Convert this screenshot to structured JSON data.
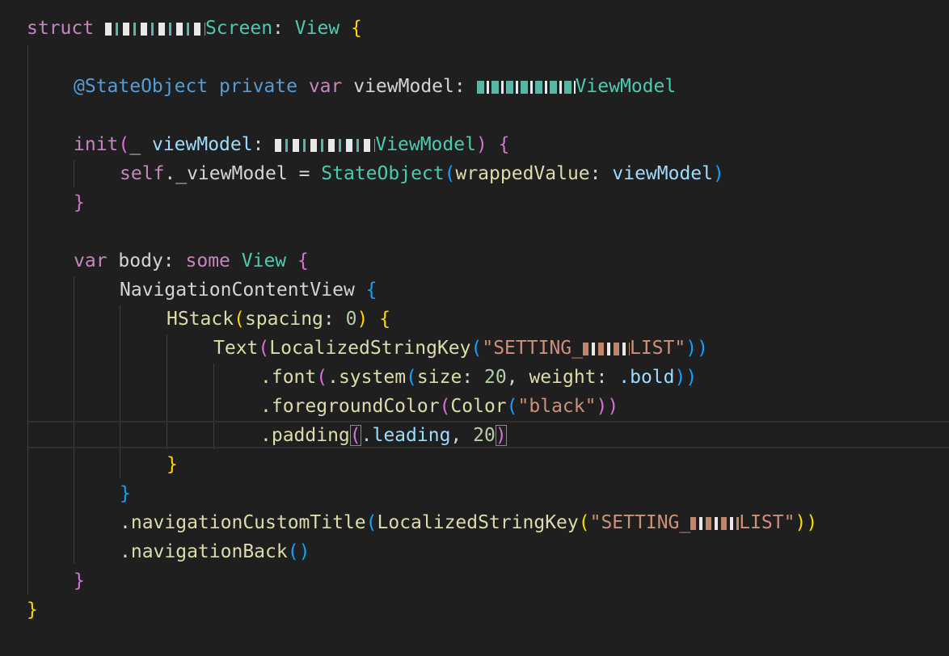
{
  "editor": {
    "lines": {
      "l1": {
        "kw_struct": "struct",
        "name_suffix": "Screen",
        "colon": ":",
        "proto": "View",
        "brace": "{"
      },
      "l3": {
        "attr": "@StateObject",
        "kw_private": "private",
        "kw_var": "var",
        "name": "viewModel",
        "colon": ":",
        "type_suffix": "ViewModel"
      },
      "l5": {
        "kw_init": "init",
        "paren": "(",
        "underscore": "_",
        "param": "viewModel",
        "colon": ":",
        "type_suffix": "ViewModel",
        "close_paren": ")",
        "brace": "{"
      },
      "l6": {
        "self": "self",
        "member": "._viewModel",
        "eq": "=",
        "ctor": "StateObject",
        "paren": "(",
        "label": "wrappedValue",
        "colon": ":",
        "arg": "viewModel",
        "close_paren": ")"
      },
      "l7": {
        "brace": "}"
      },
      "l9": {
        "kw_var": "var",
        "name": "body",
        "colon": ":",
        "kw_some": "some",
        "type": "View",
        "brace": "{"
      },
      "l10": {
        "name": "NavigationContentView",
        "brace": "{"
      },
      "l11": {
        "name": "HStack",
        "paren": "(",
        "label": "spacing",
        "colon": ":",
        "value": "0",
        "close_paren": ")",
        "brace": "{"
      },
      "l12": {
        "name": "Text",
        "paren": "(",
        "ctor": "LocalizedStringKey",
        "paren2": "(",
        "str_start": "\"SETTING_",
        "str_end": "LIST\"",
        "close": "))"
      },
      "l13": {
        "method": ".font",
        "paren": "(",
        "system": ".system",
        "paren2": "(",
        "label1": "size",
        "colon1": ":",
        "value1": "20",
        "comma": ",",
        "label2": "weight",
        "colon2": ":",
        "value2": ".bold",
        "close": "))"
      },
      "l14": {
        "method": ".foregroundColor",
        "paren": "(",
        "ctor": "Color",
        "paren2": "(",
        "str": "\"black\"",
        "close": "))"
      },
      "l15": {
        "method": ".padding",
        "paren": "(",
        "value1": ".leading",
        "comma": ",",
        "value2": "20",
        "close": ")"
      },
      "l16": {
        "brace": "}"
      },
      "l17": {
        "brace": "}"
      },
      "l18": {
        "method": ".navigationCustomTitle",
        "paren": "(",
        "ctor": "LocalizedStringKey",
        "paren2": "(",
        "str_start": "\"SETTING_",
        "str_end": "LIST\"",
        "close": "))"
      },
      "l19": {
        "method": ".navigationBack",
        "parens": "()"
      },
      "l20": {
        "brace": "}"
      },
      "l21": {
        "brace": "}"
      }
    },
    "colors": {
      "background": "#1f1f1f",
      "keyword": "#c586c0",
      "storage": "#569cd6",
      "type": "#4ec9b0",
      "identifier": "#9cdcfe",
      "function": "#dcdcaa",
      "string": "#ce9178",
      "number": "#b5cea8"
    }
  }
}
